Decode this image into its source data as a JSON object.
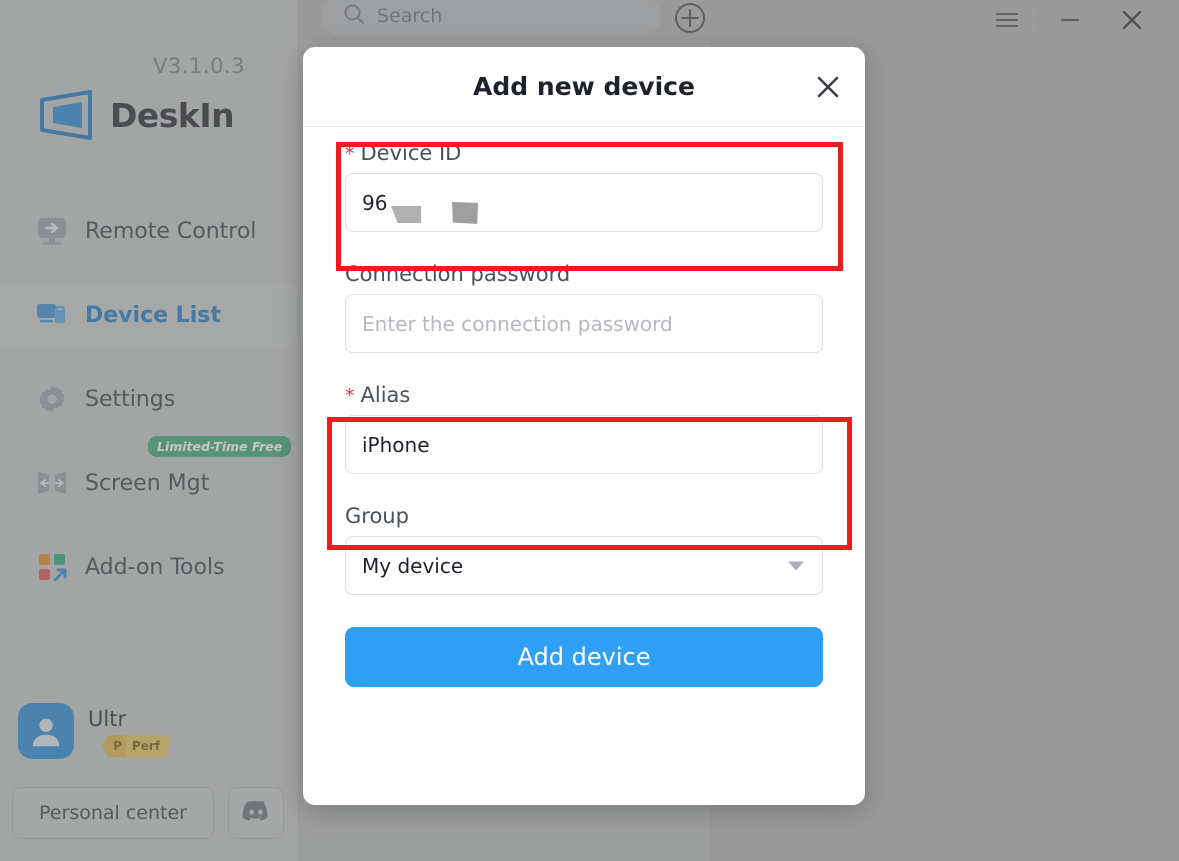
{
  "app": {
    "version": "V3.1.0.3",
    "brand": "DeskIn",
    "logo_icon": "deskin-logo-icon"
  },
  "topbar": {
    "search_placeholder": "Search",
    "search_icon": "search-icon",
    "add_icon": "plus-circle-icon",
    "menu_icon": "hamburger-menu-icon",
    "minimize_icon": "minimize-icon",
    "close_icon": "close-icon"
  },
  "sidebar": {
    "items": [
      {
        "label": "Remote Control",
        "icon": "monitor-arrow-icon",
        "active": false,
        "badge": null
      },
      {
        "label": "Device List",
        "icon": "devices-icon",
        "active": true,
        "badge": null
      },
      {
        "label": "Settings",
        "icon": "gear-icon",
        "active": false,
        "badge": null
      },
      {
        "label": "Screen Mgt",
        "icon": "screen-split-icon",
        "active": false,
        "badge": "Limited-Time Free"
      },
      {
        "label": "Add-on Tools",
        "icon": "grid-apps-icon",
        "active": false,
        "badge": null
      }
    ],
    "user": {
      "name": "Ultr",
      "avatar_icon": "user-avatar-icon",
      "plan_prefix": "P",
      "plan_label": "Perf"
    },
    "footer": {
      "personal_center": "Personal center",
      "discord_icon": "discord-icon"
    }
  },
  "modal": {
    "title": "Add new device",
    "close_icon": "close-icon",
    "fields": {
      "device_id": {
        "label": "Device ID",
        "required_mark": "*",
        "value": "96",
        "redacted": true
      },
      "connection_password": {
        "label": "Connection password",
        "required_mark": "",
        "value": "",
        "placeholder": "Enter the connection password"
      },
      "alias": {
        "label": "Alias",
        "required_mark": "*",
        "value": "iPhone"
      },
      "group": {
        "label": "Group",
        "required_mark": "",
        "value": "My device",
        "caret_icon": "chevron-down-icon"
      }
    },
    "submit_label": "Add device"
  },
  "annotations": {
    "highlight_color": "#ee1c21",
    "boxes": [
      "device-id-field",
      "alias-field"
    ]
  },
  "colors": {
    "accent_blue": "#2fa0f5",
    "active_nav": "#1f7ac4",
    "badge_green": "#3fa87a",
    "plan_gold": "#e7c45d",
    "required_red": "#d9363e"
  }
}
